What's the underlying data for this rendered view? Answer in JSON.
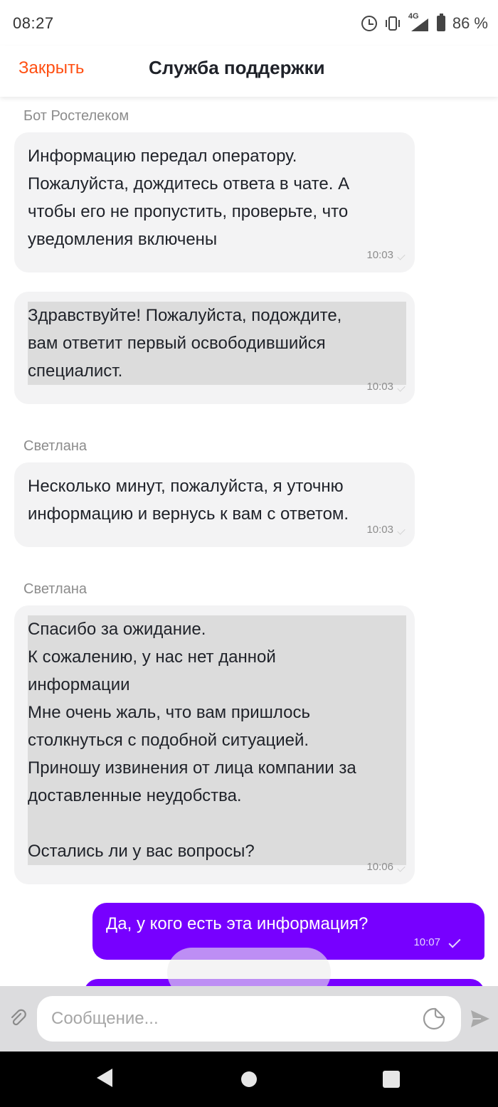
{
  "status_bar": {
    "time": "08:27",
    "network": "4G",
    "battery_percent": "86 %",
    "icons": [
      "alarm-icon",
      "vibrate-icon",
      "signal-icon",
      "battery-icon"
    ]
  },
  "header": {
    "close_label": "Закрыть",
    "title": "Служба поддержки",
    "accent_color": "#ff4f12"
  },
  "chat": {
    "messages": [
      {
        "sender": "Бот Ростелеком",
        "text": "Информацию передал оператору.\nПожалуйста, дождитесь ответа в чате. А\nчтобы его не пропустить, проверьте, что\nуведомления включены",
        "time": "10:03"
      },
      {
        "sender": "",
        "text": "Здравствуйте! Пожалуйста, подождите,\nвам ответит первый освободившийся\nспециалист.",
        "time": "10:03"
      },
      {
        "sender": "Светлана",
        "text": "Несколько минут, пожалуйста, я уточню\nинформацию и вернусь к вам с ответом.",
        "time": "10:03"
      },
      {
        "sender": "Светлана",
        "text": "Спасибо за ожидание.\nК сожалению, у нас нет данной\nинформации\nМне очень жаль, что вам пришлось\nстолкнуться с подобной ситуацией.\nПриношу извинения от лица компании за\nдоставленные неудобства.\n\nОстались ли у вас вопросы?",
        "time": "10:06"
      }
    ],
    "outgoing": {
      "text": "Да, у кого есть эта информация?",
      "time": "10:07",
      "color": "#7700ff"
    }
  },
  "composer": {
    "placeholder": "Сообщение...",
    "icons": [
      "paperclip-icon",
      "sticker-icon",
      "send-icon"
    ]
  },
  "nav_bar": {
    "icons": [
      "back-icon",
      "home-icon",
      "recents-icon"
    ]
  }
}
